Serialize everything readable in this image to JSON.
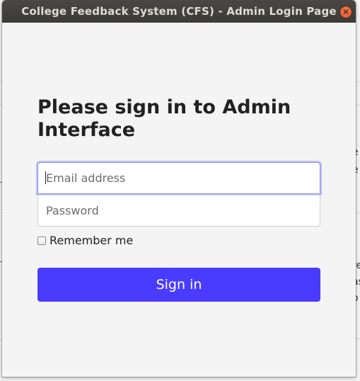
{
  "window": {
    "title": "College Feedback System (CFS) - Admin Login Page",
    "close_icon": "close-icon",
    "close_color": "#e95420"
  },
  "form": {
    "heading": "Please sign in to Admin Interface",
    "email_placeholder": "Email address",
    "password_placeholder": "Password",
    "remember_label": "Remember me",
    "remember_checked": false,
    "submit_label": "Sign in",
    "submit_color": "#4a3cff"
  },
  "background": {
    "fragments": [
      "e",
      "e",
      "re",
      "as",
      "o"
    ]
  }
}
